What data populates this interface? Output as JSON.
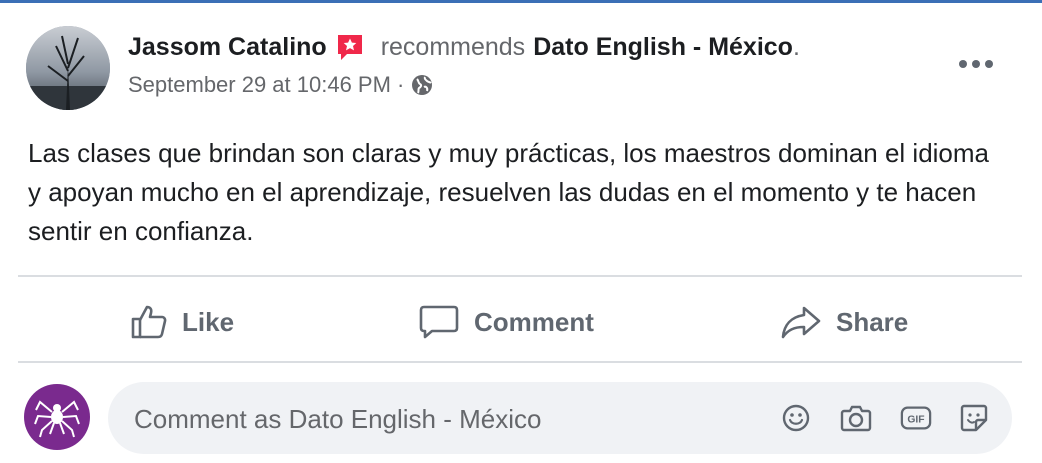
{
  "post": {
    "author": "Jassom Catalino",
    "verb": "recommends",
    "page": "Dato English - México",
    "period": ".",
    "timestamp": "September 29 at 10:46 PM",
    "separator": "·",
    "body": "Las clases que brindan son claras y muy prácticas, los maestros dominan el idioma y apoyan mucho en el aprendizaje, resuelven las dudas en el momento y te hacen sentir en confianza."
  },
  "actions": {
    "like_label": "Like",
    "comment_label": "Comment",
    "share_label": "Share"
  },
  "comment": {
    "placeholder": "Comment as Dato English - México",
    "icons": [
      "emoji-icon",
      "camera-icon",
      "gif-icon",
      "sticker-icon"
    ]
  },
  "colors": {
    "accent": "#3b6fb6",
    "recommend_badge": "#f0284a",
    "page_avatar": "#7a2a8e",
    "secondary_text": "#65676b",
    "action_text": "#606770"
  }
}
